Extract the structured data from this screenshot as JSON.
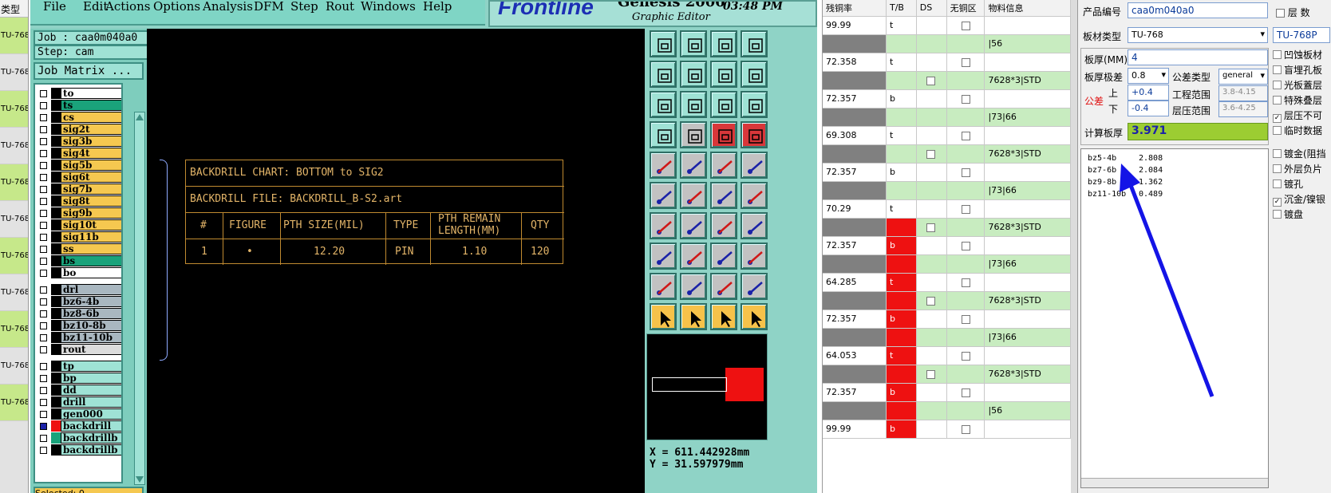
{
  "strip": {
    "header": "类型",
    "rows": [
      "TU-768",
      "TU-768",
      "TU-768I",
      "TU-768",
      "TU-768I",
      "TU-768",
      "TU-768I",
      "TU-768",
      "TU-768I",
      "TU-768",
      "TU-768I"
    ]
  },
  "menu": {
    "file": "File",
    "edit": "Edit",
    "actions": "Actions",
    "options": "Options",
    "analysis": "Analysis",
    "dfm": "DFM",
    "step": "Step",
    "rout": "Rout",
    "windows": "Windows",
    "help": "Help"
  },
  "logo": {
    "brand": "Frontline",
    "product": "Genesis 2000",
    "sub": "Graphic Editor",
    "time": "03:48 PM"
  },
  "job": {
    "job": "Job : caa0m040a0",
    "step": "Step: cam",
    "matrix": "Job Matrix ..."
  },
  "layers": [
    {
      "name": "to",
      "color": "#ffffff"
    },
    {
      "name": "ts",
      "color": "#1aa37b"
    },
    {
      "name": "cs",
      "color": "#f5c850"
    },
    {
      "name": "sig2t",
      "color": "#f5c850"
    },
    {
      "name": "sig3b",
      "color": "#f5c850"
    },
    {
      "name": "sig4t",
      "color": "#f5c850"
    },
    {
      "name": "sig5b",
      "color": "#f5c850"
    },
    {
      "name": "sig6t",
      "color": "#f5c850"
    },
    {
      "name": "sig7b",
      "color": "#f5c850"
    },
    {
      "name": "sig8t",
      "color": "#f5c850"
    },
    {
      "name": "sig9b",
      "color": "#f5c850"
    },
    {
      "name": "sig10t",
      "color": "#f5c850"
    },
    {
      "name": "sig11b",
      "color": "#f5c850"
    },
    {
      "name": "ss",
      "color": "#f5c850"
    },
    {
      "name": "bs",
      "color": "#1aa37b"
    },
    {
      "name": "bo",
      "color": "#ffffff"
    },
    {
      "name": "drl",
      "color": "#a9b7c0"
    },
    {
      "name": "bz6-4b",
      "color": "#a9b7c0"
    },
    {
      "name": "bz8-6b",
      "color": "#a9b7c0"
    },
    {
      "name": "bz10-8b",
      "color": "#a9b7c0"
    },
    {
      "name": "bz11-10b",
      "color": "#a9b7c0"
    },
    {
      "name": "rout",
      "color": "#dcdcdc"
    },
    {
      "name": "tp",
      "color": "#9fe2d5"
    },
    {
      "name": "bp",
      "color": "#9fe2d5"
    },
    {
      "name": "dd",
      "color": "#9fe2d5"
    },
    {
      "name": "drill",
      "color": "#9fe2d5"
    },
    {
      "name": "gen000",
      "color": "#9fe2d5"
    },
    {
      "name": "backdrill",
      "color": "#9fe2d5"
    },
    {
      "name": "backdrillb",
      "color": "#9fe2d5"
    },
    {
      "name": "backdrillb",
      "color": "#9fe2d5"
    }
  ],
  "bottom_left": "Selected: 0",
  "chart": {
    "title": "BACKDRILL CHART: BOTTOM to SIG2",
    "file": "BACKDRILL FILE: BACKDRILL_B-S2.art",
    "headers": [
      "#",
      "FIGURE",
      "PTH SIZE(MIL)",
      "TYPE",
      "PTH REMAIN",
      "LENGTH(MM)",
      "QTY"
    ],
    "row": [
      "1",
      "•",
      "12.20",
      "PIN",
      "1.10",
      "120"
    ]
  },
  "coords": {
    "x": "X = 611.442928mm",
    "y": "Y = 31.597979mm"
  },
  "grid": {
    "headers": [
      "残铜率",
      "T/B",
      "DS",
      "无铜区",
      "物料信息"
    ],
    "rows": [
      {
        "v": "99.99",
        "tb": "t",
        "m": "",
        "alt": false,
        "gray": false,
        "red": false,
        "ds": false
      },
      {
        "v": "",
        "tb": "",
        "m": "|56",
        "alt": true,
        "gray": true,
        "red": false,
        "ds": false
      },
      {
        "v": "72.358",
        "tb": "t",
        "m": "",
        "alt": false,
        "gray": false,
        "red": false,
        "ds": false
      },
      {
        "v": "",
        "tb": "",
        "m": "7628*3|STD",
        "alt": true,
        "gray": true,
        "red": false,
        "ds": true
      },
      {
        "v": "72.357",
        "tb": "b",
        "m": "",
        "alt": false,
        "gray": false,
        "red": false,
        "ds": false
      },
      {
        "v": "",
        "tb": "",
        "m": "|73|66",
        "alt": true,
        "gray": true,
        "red": false,
        "ds": false
      },
      {
        "v": "69.308",
        "tb": "t",
        "m": "",
        "alt": false,
        "gray": false,
        "red": false,
        "ds": false
      },
      {
        "v": "",
        "tb": "",
        "m": "7628*3|STD",
        "alt": true,
        "gray": true,
        "red": false,
        "ds": true
      },
      {
        "v": "72.357",
        "tb": "b",
        "m": "",
        "alt": false,
        "gray": false,
        "red": false,
        "ds": false
      },
      {
        "v": "",
        "tb": "",
        "m": "|73|66",
        "alt": true,
        "gray": true,
        "red": false,
        "ds": false
      },
      {
        "v": "70.29",
        "tb": "t",
        "m": "",
        "alt": false,
        "gray": false,
        "red": false,
        "ds": false
      },
      {
        "v": "",
        "tb": "",
        "m": "7628*3|STD",
        "alt": true,
        "gray": true,
        "red": true,
        "ds": true
      },
      {
        "v": "72.357",
        "tb": "b",
        "m": "",
        "alt": false,
        "gray": false,
        "red": true,
        "ds": false
      },
      {
        "v": "",
        "tb": "",
        "m": "|73|66",
        "alt": true,
        "gray": true,
        "red": true,
        "ds": false
      },
      {
        "v": "64.285",
        "tb": "t",
        "m": "",
        "alt": false,
        "gray": false,
        "red": true,
        "ds": false
      },
      {
        "v": "",
        "tb": "",
        "m": "7628*3|STD",
        "alt": true,
        "gray": true,
        "red": true,
        "ds": true
      },
      {
        "v": "72.357",
        "tb": "b",
        "m": "",
        "alt": false,
        "gray": false,
        "red": true,
        "ds": false
      },
      {
        "v": "",
        "tb": "",
        "m": "|73|66",
        "alt": true,
        "gray": true,
        "red": true,
        "ds": false
      },
      {
        "v": "64.053",
        "tb": "t",
        "m": "",
        "alt": false,
        "gray": false,
        "red": true,
        "ds": false
      },
      {
        "v": "",
        "tb": "",
        "m": "7628*3|STD",
        "alt": true,
        "gray": true,
        "red": true,
        "ds": true
      },
      {
        "v": "72.357",
        "tb": "b",
        "m": "",
        "alt": false,
        "gray": false,
        "red": true,
        "ds": false
      },
      {
        "v": "",
        "tb": "",
        "m": "|56",
        "alt": true,
        "gray": true,
        "red": true,
        "ds": false
      },
      {
        "v": "99.99",
        "tb": "b",
        "m": "",
        "alt": false,
        "gray": false,
        "red": true,
        "ds": false
      }
    ]
  },
  "form": {
    "product_label": "产品编号",
    "product_value": "caa0m040a0",
    "layers_label": "层 数",
    "board_type_label": "板材类型",
    "board_type_value": "TU-768",
    "board_type_extra": "TU-768P",
    "thickness_label": "板厚(MM)",
    "thickness_value": "4",
    "tol_label": "板厚极差",
    "tol_value": "0.8",
    "tol_type_label": "公差类型",
    "tol_type_value": "general",
    "tol_side_label": "公差",
    "upper_label": "上",
    "upper_value": "+0.4",
    "lower_label": "下",
    "lower_value": "-0.4",
    "eng_range_label": "工程范围",
    "eng_range_value": "3.8-4.15",
    "press_range_label": "层压范围",
    "press_range_value": "3.6-4.25",
    "calc_label": "计算板厚",
    "calc_value": "3.971",
    "list": [
      {
        "n": "bz5-4b",
        "v": "2.808"
      },
      {
        "n": "bz7-6b",
        "v": "2.084"
      },
      {
        "n": "bz9-8b",
        "v": "1.362"
      },
      {
        "n": "bz11-10b",
        "v": "0.489"
      }
    ],
    "checks": [
      {
        "label": "凹蚀板材",
        "checked": false
      },
      {
        "label": "盲埋孔板",
        "checked": false
      },
      {
        "label": "光板蓋层",
        "checked": false
      },
      {
        "label": "特殊叠层",
        "checked": false
      },
      {
        "label": "层压不可",
        "checked": true
      },
      {
        "label": "临时数据",
        "checked": false
      },
      {
        "label": "镀金(阻挡",
        "checked": false
      },
      {
        "label": "外层负片",
        "checked": false
      },
      {
        "label": "镀孔",
        "checked": false
      },
      {
        "label": "沉金/镍银",
        "checked": true
      },
      {
        "label": "镀盘",
        "checked": false
      }
    ],
    "colors": {
      "calc_bg": "#9ccd32",
      "arrow": "#1414e6"
    }
  }
}
